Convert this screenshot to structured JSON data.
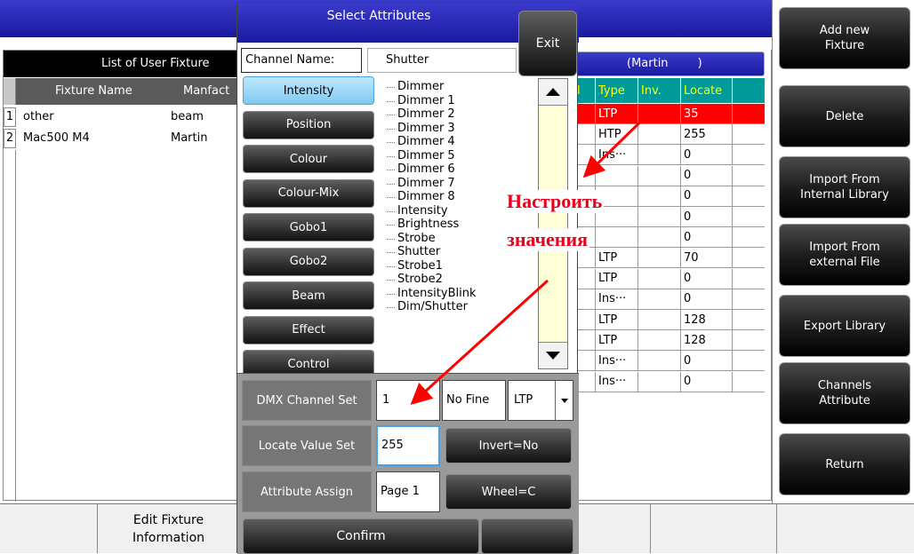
{
  "fixture_list": {
    "title": "List of User Fixture",
    "columns": [
      "Fixture Name",
      "Manfact"
    ],
    "rows": [
      {
        "num": "1",
        "name": "other",
        "maker": "beam"
      },
      {
        "num": "2",
        "name": "Mac500 M4",
        "maker": "Martin"
      }
    ]
  },
  "channel_table": {
    "header_label": "(Martin        )",
    "columns": [
      "l",
      "Type",
      "Inv.",
      "Locate"
    ],
    "rows": [
      {
        "type": "LTP",
        "inv": "",
        "locate": "35",
        "selected": true
      },
      {
        "type": "HTP",
        "inv": "",
        "locate": "255"
      },
      {
        "type": "Ins···",
        "inv": "",
        "locate": "0"
      },
      {
        "type": "",
        "inv": "",
        "locate": "0"
      },
      {
        "type": "",
        "inv": "",
        "locate": "0"
      },
      {
        "type": "",
        "inv": "",
        "locate": "0"
      },
      {
        "type": "",
        "inv": "",
        "locate": "0"
      },
      {
        "type": "LTP",
        "inv": "",
        "locate": "70"
      },
      {
        "type": "LTP",
        "inv": "",
        "locate": "0"
      },
      {
        "type": "Ins···",
        "inv": "",
        "locate": "0"
      },
      {
        "type": "LTP",
        "inv": "",
        "locate": "128"
      },
      {
        "type": "LTP",
        "inv": "",
        "locate": "128"
      },
      {
        "type": "Ins···",
        "inv": "",
        "locate": "0"
      },
      {
        "type": "Ins···",
        "inv": "",
        "locate": "0"
      }
    ]
  },
  "dialog": {
    "title": "Select Attributes",
    "exit_label": "Exit",
    "channel_name_label": "Channel Name:",
    "channel_name_value": "Shutter",
    "categories": [
      "Intensity",
      "Position",
      "Colour",
      "Colour-Mix",
      "Gobo1",
      "Gobo2",
      "Beam",
      "Effect",
      "Control"
    ],
    "selected_category": "Intensity",
    "attributes": [
      "Dimmer",
      "Dimmer 1",
      "Dimmer 2",
      "Dimmer 3",
      "Dimmer 4",
      "Dimmer 5",
      "Dimmer 6",
      "Dimmer 7",
      "Dimmer 8",
      "Intensity",
      "Brightness",
      "Strobe",
      "Shutter",
      "Strobe1",
      "Strobe2",
      "IntensityBlink",
      "Dim/Shutter"
    ],
    "dmx_channel_label": "DMX Channel Set",
    "dmx_channel_value": "1",
    "fine_label": "No Fine",
    "mode_value": "LTP",
    "locate_label": "Locate Value Set",
    "locate_value": "255",
    "invert_label": "Invert=No",
    "attr_assign_label": "Attribute Assign",
    "page_value": "Page 1",
    "wheel_label": "Wheel=C",
    "confirm_label": "Confirm"
  },
  "annotation": {
    "line1": "Настроить",
    "line2": "значения",
    "color": "#e8001c"
  },
  "side_buttons": [
    "Add new\nFixture",
    "Delete",
    "Import From\nInternal Library",
    "Import From\nexternal File",
    "Export Library",
    "Channels\nAttribute",
    "Return"
  ],
  "bottom_bar": {
    "edit_fixture_label": "Edit Fixture\nInformation"
  },
  "colors": {
    "title_blue": "#2222b0",
    "teal_header": "#00999a",
    "selected_row": "#ff0000",
    "header_text_yellow": "#ffff00",
    "category_selected": "#8fd3f4"
  }
}
